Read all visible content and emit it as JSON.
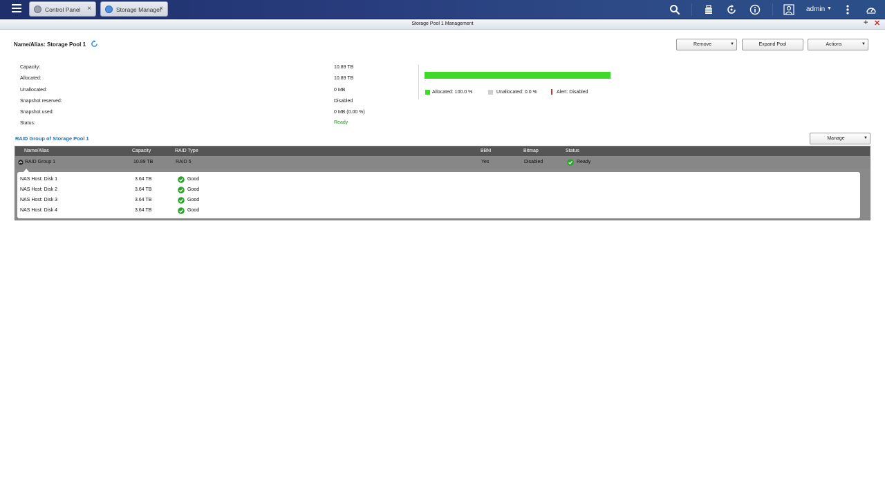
{
  "taskbar": {
    "tabs": [
      {
        "label": "Control Panel",
        "close": "×"
      },
      {
        "label": "Storage Manager",
        "close": "×"
      }
    ],
    "user": "admin"
  },
  "window": {
    "title": "Storage Pool 1 Management",
    "plus": "+",
    "close": "✕"
  },
  "pool": {
    "name_label": "Name/Alias: Storage Pool 1",
    "buttons": {
      "remove": "Remove",
      "expand": "Expand Pool",
      "actions": "Actions"
    }
  },
  "info": [
    {
      "label": "Capacity:",
      "value": "10.89 TB"
    },
    {
      "label": "Allocated:",
      "value": "10.89 TB"
    },
    {
      "label": "Unallocated:",
      "value": "0 MB"
    },
    {
      "label": "Snapshot reserved:",
      "value": "Disabled"
    },
    {
      "label": "Snapshot used:",
      "value": "0 MB (0.00 %)"
    },
    {
      "label": "Status:",
      "value": "Ready"
    }
  ],
  "usage": {
    "allocated_fraction": 1.0,
    "legend": {
      "allocated": "Allocated: 100.0 %",
      "unallocated": "Unallocated: 0.0 %",
      "alert": "Alert: Disabled"
    },
    "colors": {
      "allocated": "#3fd92a",
      "unallocated": "#cfcfcf",
      "alert": "#c23333"
    }
  },
  "raid": {
    "section_title": "RAID Group of Storage Pool 1",
    "manage_label": "Manage",
    "columns": [
      "Name/Alias",
      "Capacity",
      "RAID Type",
      "BBM",
      "Bitmap",
      "Status"
    ],
    "group": {
      "name": "RAID Group 1",
      "capacity": "10.89 TB",
      "raid_type": "RAID 5",
      "bbm": "Yes",
      "bitmap": "Disabled",
      "status": "Ready"
    },
    "disks": [
      {
        "name": "NAS Host: Disk 1",
        "capacity": "3.64 TB",
        "status": "Good"
      },
      {
        "name": "NAS Host: Disk 2",
        "capacity": "3.64 TB",
        "status": "Good"
      },
      {
        "name": "NAS Host: Disk 3",
        "capacity": "3.64 TB",
        "status": "Good"
      },
      {
        "name": "NAS Host: Disk 4",
        "capacity": "3.64 TB",
        "status": "Good"
      }
    ]
  }
}
